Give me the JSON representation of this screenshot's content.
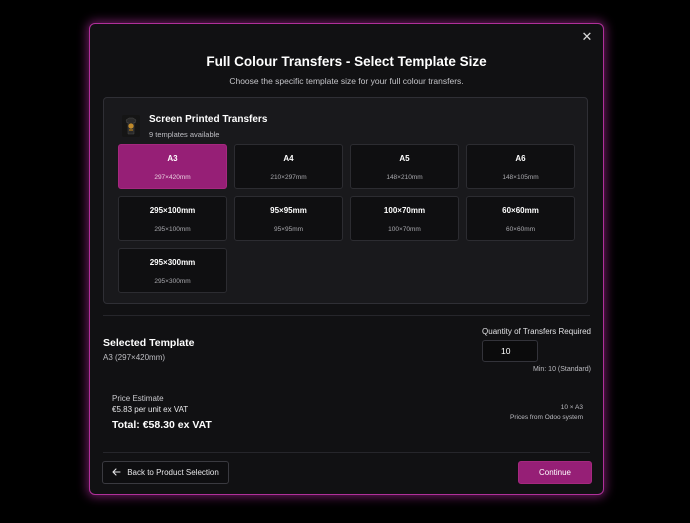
{
  "dialog": {
    "title": "Full Colour Transfers - Select Template Size",
    "subtitle": "Choose the specific template size for your full colour transfers.",
    "close_icon": "close-icon",
    "accent_color": "#961f76"
  },
  "template_group": {
    "title": "Screen Printed Transfers",
    "count_text": "9 templates available",
    "thumbnail_icon": "tshirt-thumbnail",
    "templates": [
      {
        "name": "A3",
        "dimensions": "297×420mm",
        "selected": true
      },
      {
        "name": "A4",
        "dimensions": "210×297mm",
        "selected": false
      },
      {
        "name": "A5",
        "dimensions": "148×210mm",
        "selected": false
      },
      {
        "name": "A6",
        "dimensions": "148×105mm",
        "selected": false
      },
      {
        "name": "295×100mm",
        "dimensions": "295×100mm",
        "selected": false
      },
      {
        "name": "95×95mm",
        "dimensions": "95×95mm",
        "selected": false
      },
      {
        "name": "100×70mm",
        "dimensions": "100×70mm",
        "selected": false
      },
      {
        "name": "60×60mm",
        "dimensions": "60×60mm",
        "selected": false
      },
      {
        "name": "295×300mm",
        "dimensions": "295×300mm",
        "selected": false
      }
    ]
  },
  "selection": {
    "title": "Selected Template",
    "value": "A3 (297×420mm)"
  },
  "quantity": {
    "label": "Quantity of Transfers Required",
    "value": "10",
    "min_text": "Min: 10 (Standard)"
  },
  "price": {
    "label": "Price Estimate",
    "unit_text": "€5.83 per unit ex VAT",
    "total_text": "Total: €58.30 ex VAT",
    "qty_summary": "10 × A3",
    "source_text": "Prices from Odoo system"
  },
  "buttons": {
    "back_label": "Back to Product Selection",
    "back_icon": "arrow-left-icon",
    "continue_label": "Continue"
  }
}
